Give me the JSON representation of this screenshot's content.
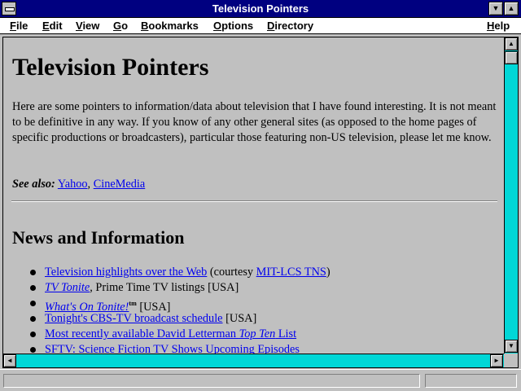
{
  "window": {
    "title": "Television Pointers",
    "minimize_glyph": "▼",
    "maximize_glyph": "▲"
  },
  "menu": [
    {
      "label": "File"
    },
    {
      "label": "Edit"
    },
    {
      "label": "View"
    },
    {
      "label": "Go"
    },
    {
      "label": "Bookmarks"
    },
    {
      "label": "Options"
    },
    {
      "label": "Directory"
    },
    {
      "label": "Help"
    }
  ],
  "page": {
    "heading": "Television Pointers",
    "intro": "Here are some pointers to information/data about television that I have found interesting. It is not meant to be definitive in any way. If you know of any other general sites (as opposed to the home pages of specific productions or broadcasters), particular those featuring non-US television, please let me know.",
    "see_also_label": "See also:",
    "see_also_links": [
      "Yahoo",
      "CineMedia"
    ],
    "see_also_sep": ", ",
    "section_heading": "News and Information",
    "news": [
      {
        "link": "Television highlights over the Web",
        "text1": " (courtesy ",
        "link2": "MIT-LCS TNS",
        "text2": ")"
      },
      {
        "link_italic": "TV Tonite",
        "text1": ", Prime Time TV listings [USA]"
      },
      {
        "link_italic": "What's On Tonite!",
        "sup": "tm",
        "text1": " [USA]"
      },
      {
        "link": "Tonight's CBS-TV broadcast schedule",
        "text1": " [USA]"
      },
      {
        "link": "Most recently available David Letterman ",
        "link_italic_tail": "Top Ten",
        "link_tail": " List"
      },
      {
        "link": "SFTV: Science Fiction TV Shows Upcoming Episodes"
      }
    ]
  },
  "scroll": {
    "up": "▲",
    "down": "▼",
    "left": "◄",
    "right": "►"
  },
  "status": {
    "text": "",
    "progress": ""
  }
}
